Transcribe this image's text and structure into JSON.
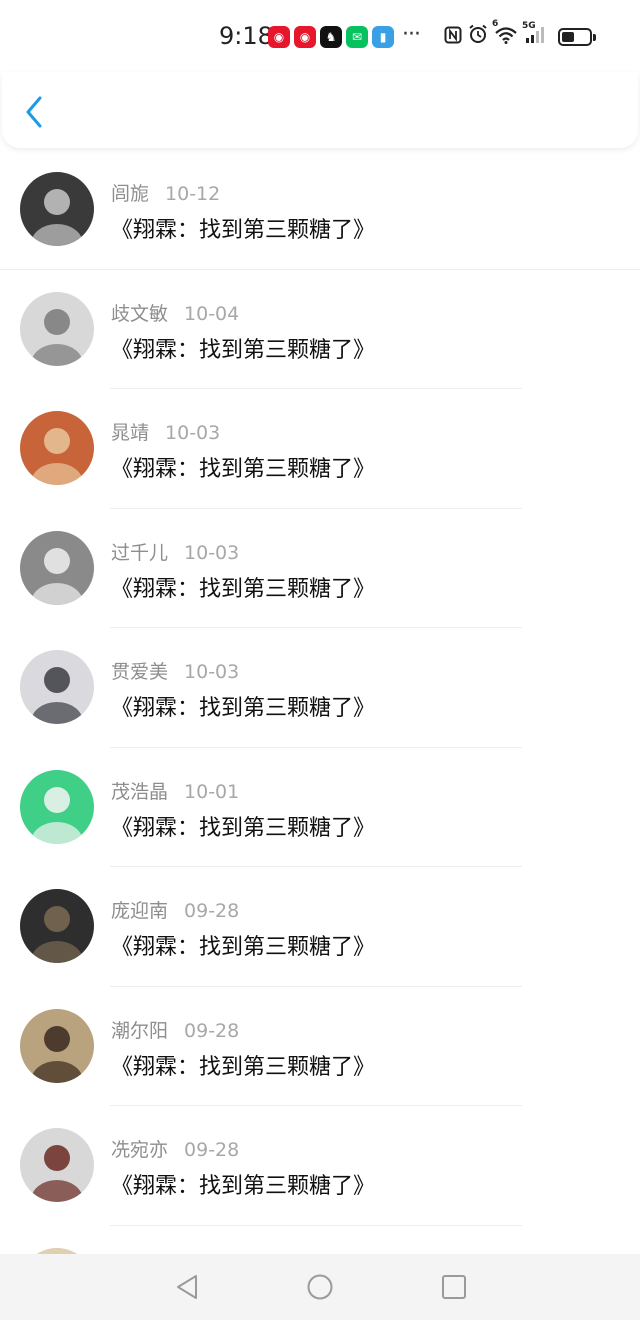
{
  "status_bar": {
    "time": "9:18",
    "app_icons": [
      {
        "name": "weibo-icon",
        "color": "#e6162d",
        "glyph": "◉"
      },
      {
        "name": "weibo-icon",
        "color": "#e6162d",
        "glyph": "◉"
      },
      {
        "name": "qq-icon",
        "color": "#111111",
        "glyph": "♞"
      },
      {
        "name": "wechat-icon",
        "color": "#07c160",
        "glyph": "✉"
      },
      {
        "name": "app-icon",
        "color": "#3aa0e6",
        "glyph": "▮"
      }
    ],
    "more": "···",
    "signal_label": "5G",
    "wifi_label": "6"
  },
  "comments": [
    {
      "name": "闾旎",
      "date": "10-12",
      "text": "《翔霖：找到第三颗糖了》",
      "avatar": {
        "bg": "#3a3a3a",
        "fg": "#c8c8c8"
      }
    },
    {
      "name": "歧文敏",
      "date": "10-04",
      "text": "《翔霖：找到第三颗糖了》",
      "avatar": {
        "bg": "#d8d8d8",
        "fg": "#7a7a7a"
      }
    },
    {
      "name": "晁靖",
      "date": "10-03",
      "text": "《翔霖：找到第三颗糖了》",
      "avatar": {
        "bg": "#c8643a",
        "fg": "#e8c49a"
      }
    },
    {
      "name": "过千儿",
      "date": "10-03",
      "text": "《翔霖：找到第三颗糖了》",
      "avatar": {
        "bg": "#8a8a8a",
        "fg": "#efefef"
      }
    },
    {
      "name": "贯爱美",
      "date": "10-03",
      "text": "《翔霖：找到第三颗糖了》",
      "avatar": {
        "bg": "#d9d9de",
        "fg": "#3c3c44"
      }
    },
    {
      "name": "茂浩晶",
      "date": "10-01",
      "text": "《翔霖：找到第三颗糖了》",
      "avatar": {
        "bg": "#3fcf87",
        "fg": "#f4f4f4"
      }
    },
    {
      "name": "庞迎南",
      "date": "09-28",
      "text": "《翔霖：找到第三颗糖了》",
      "avatar": {
        "bg": "#2e2e2e",
        "fg": "#7a6a52"
      }
    },
    {
      "name": "潮尔阳",
      "date": "09-28",
      "text": "《翔霖：找到第三颗糖了》",
      "avatar": {
        "bg": "#b9a27e",
        "fg": "#3a2a1e"
      }
    },
    {
      "name": "冼宛亦",
      "date": "09-28",
      "text": "《翔霖：找到第三颗糖了》",
      "avatar": {
        "bg": "#d8d8d8",
        "fg": "#6b2a24"
      }
    }
  ],
  "colors": {
    "accent": "#1a9be6",
    "name_gray": "#8e8e8e",
    "date_gray": "#a8a8a8"
  }
}
